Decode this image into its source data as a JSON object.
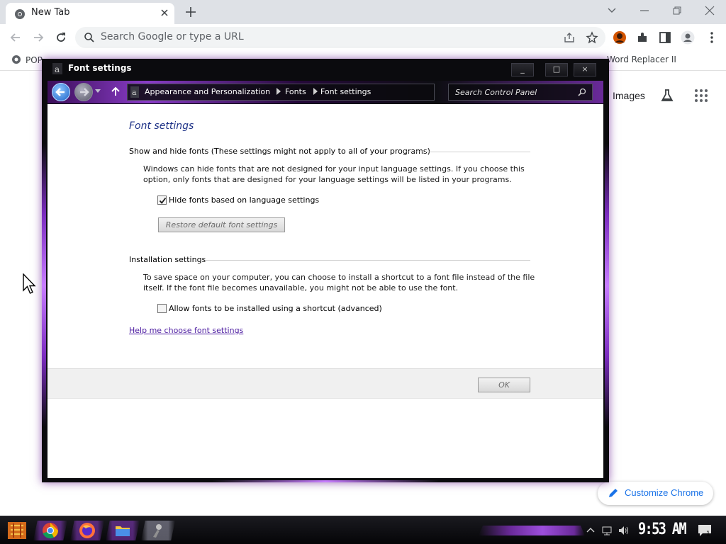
{
  "browser": {
    "tab_title": "New Tab",
    "omnibox_placeholder": "Search Google or type a URL",
    "bookmarks": [
      "POP",
      "Word Replacer II"
    ],
    "ntp_images": "Images",
    "customize_label": "Customize Chrome"
  },
  "dialog": {
    "title": "Font settings",
    "breadcrumb": [
      "Appearance and Personalization",
      "Fonts",
      "Font settings"
    ],
    "search_placeholder": "Search Control Panel",
    "page_title": "Font settings",
    "show_hide": {
      "heading": "Show and hide fonts (These settings might not apply to all of your programs)",
      "description": "Windows can hide fonts that are not designed for your input language settings. If you choose this option, only fonts that are designed for your language settings will be listed in your programs.",
      "checkbox_label": "Hide fonts based on language settings",
      "checkbox_checked": true,
      "restore_button": "Restore default font settings"
    },
    "installation": {
      "heading": "Installation settings",
      "description": "To save space on your computer, you can choose to install a shortcut to a font file instead of the file itself. If the font file becomes unavailable, you might not be able to use the font.",
      "checkbox_label": "Allow fonts to be installed using a shortcut (advanced)",
      "checkbox_checked": false
    },
    "help_link": "Help me choose font settings",
    "ok_button": "OK",
    "minimize": "_",
    "maximize": "□",
    "close": "×"
  },
  "taskbar": {
    "clock": "9:53 AM",
    "notifications": "1"
  },
  "colors": {
    "accent_purple": "#8a3cc8",
    "link": "#4b1aa0",
    "title_blue": "#1e3287",
    "chrome_blue": "#1a73e8"
  }
}
